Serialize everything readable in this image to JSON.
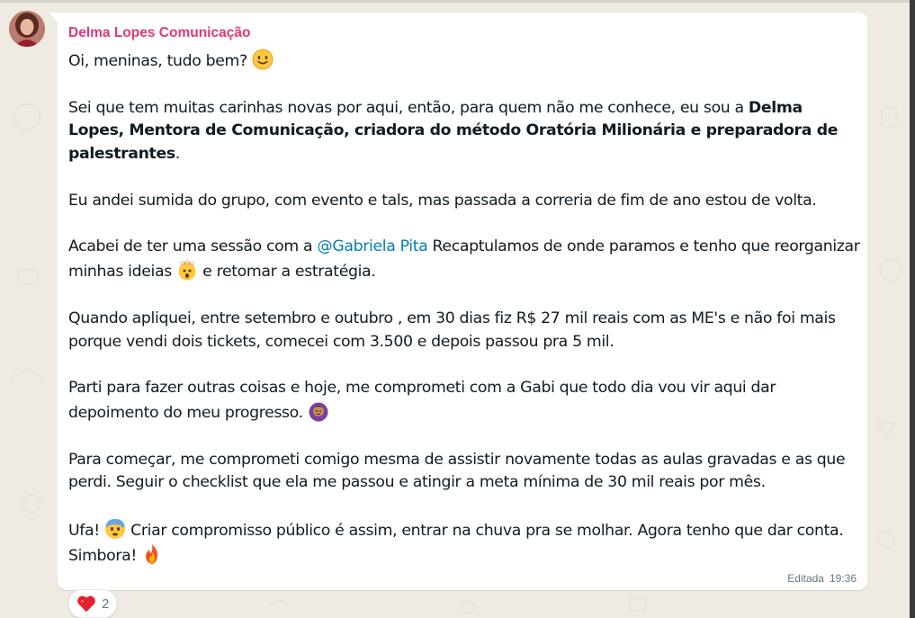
{
  "sender": {
    "name": "Delma Lopes Comunicação"
  },
  "message": {
    "greeting": "Oi, meninas, tudo bem?",
    "p1_start": "Sei que tem muitas carinhas novas por aqui, então, para quem não me conhece, eu sou a ",
    "p1_bold": "Delma Lopes, Mentora de Comunicação, criadora do método Oratória Milionária e preparadora de palestrantes",
    "p1_end": ".",
    "p2": "Eu andei sumida do grupo, com evento e tals, mas passada a correria de fim de ano estou de volta.",
    "p3_start": "Acabei de ter uma sessão com a ",
    "p3_mention": "@Gabriela Pita",
    "p3_mid": " Recaptulamos de onde paramos e tenho que reorganizar minhas ideias",
    "p3_end": " e retomar a estratégia.",
    "p4": "Quando apliquei, entre setembro e outubro , em 30 dias fiz R$ 27 mil reais com as ME's e não foi mais porque vendi dois tickets, comecei com 3.500 e depois passou pra 5 mil.",
    "p5": "Parti para fazer outras coisas e hoje, me comprometi com a Gabi que todo dia vou vir aqui dar depoimento do meu progresso.",
    "p6": "Para começar, me comprometi comigo mesma de assistir novamente todas as aulas gravadas e as que perdi. Seguir o checklist que ela me passou e atingir a meta mínima de 30 mil reais por mês.",
    "p7_start": "Ufa!",
    "p7_mid": " Criar compromisso público é assim, entrar na chuva pra se molhar. Agora tenho que dar conta. Simbora!"
  },
  "meta": {
    "edited_label": "Editada",
    "time": "19:36"
  },
  "reaction": {
    "emoji": "heart",
    "count": "2"
  },
  "colors": {
    "sender": "#e0387a",
    "mention": "#027eb5",
    "bubble": "#ffffff",
    "background": "#efeae2"
  }
}
